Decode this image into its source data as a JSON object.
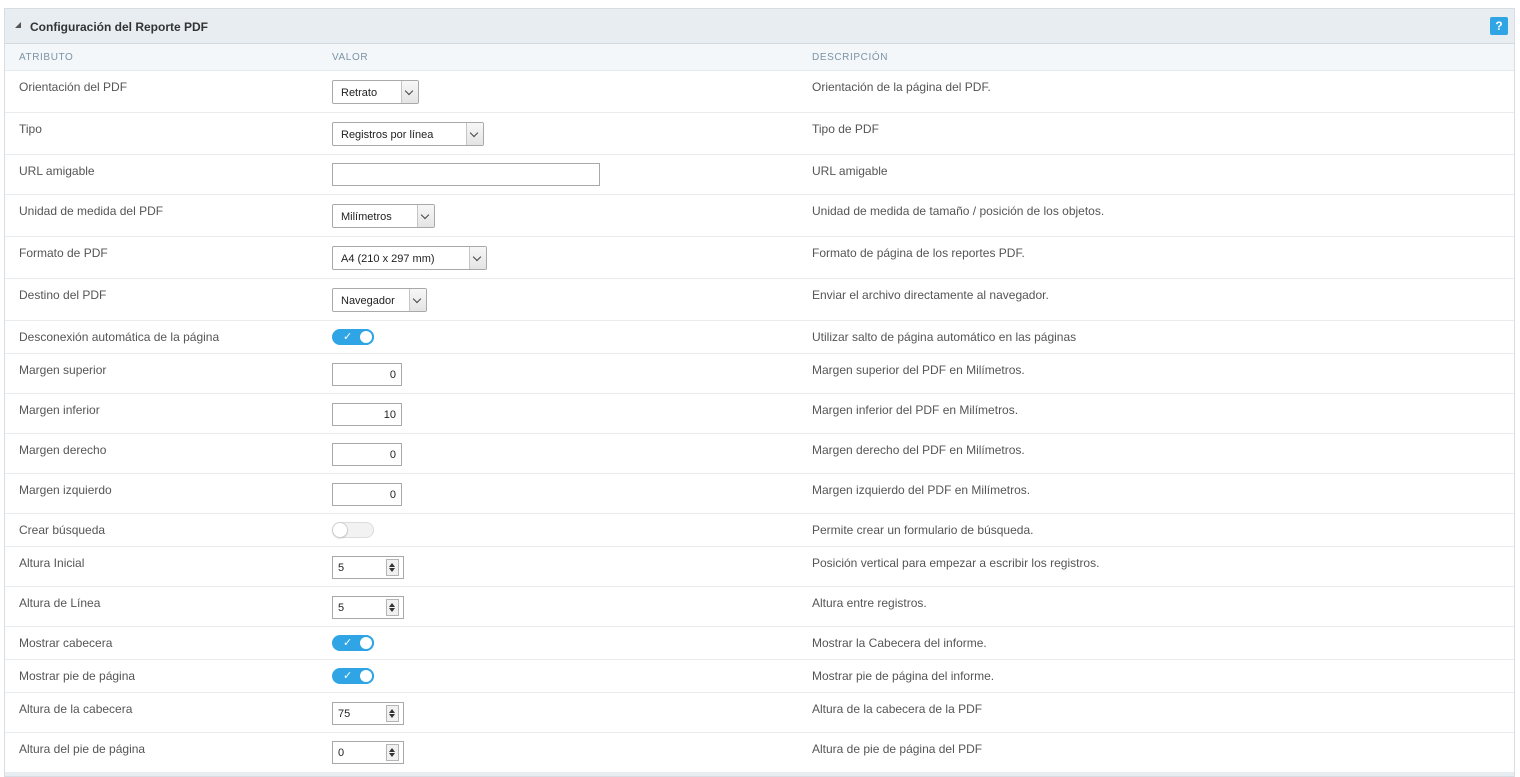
{
  "panel": {
    "title": "Configuración del Reporte PDF",
    "help_label": "?"
  },
  "columns": {
    "attribute": "ATRIBUTO",
    "value": "VALOR",
    "description": "DESCRIPCIÓN"
  },
  "rows": [
    {
      "label": "Orientación del PDF",
      "value": "Retrato",
      "description": "Orientación de la página del PDF."
    },
    {
      "label": "Tipo",
      "value": "Registros por línea",
      "description": "Tipo de PDF"
    },
    {
      "label": "URL amigable",
      "value": "",
      "description": "URL amigable"
    },
    {
      "label": "Unidad de medida del PDF",
      "value": "Milímetros",
      "description": "Unidad de medida de tamaño / posición de los objetos."
    },
    {
      "label": "Formato de PDF",
      "value": "A4 (210 x 297 mm)",
      "description": "Formato de página de los reportes PDF."
    },
    {
      "label": "Destino del PDF",
      "value": "Navegador",
      "description": "Enviar el archivo directamente al navegador."
    },
    {
      "label": "Desconexión automática de la página",
      "value": "on",
      "check": "✓",
      "description": "Utilizar salto de página automático en las páginas"
    },
    {
      "label": "Margen superior",
      "value": "0",
      "description": "Margen superior del PDF en Milímetros."
    },
    {
      "label": "Margen inferior",
      "value": "10",
      "description": "Margen inferior del PDF en Milímetros."
    },
    {
      "label": "Margen derecho",
      "value": "0",
      "description": "Margen derecho del PDF en Milímetros."
    },
    {
      "label": "Margen izquierdo",
      "value": "0",
      "description": "Margen izquierdo del PDF en Milímetros."
    },
    {
      "label": "Crear búsqueda",
      "value": "off",
      "description": "Permite crear un formulario de búsqueda."
    },
    {
      "label": "Altura Inicial",
      "value": "5",
      "description": "Posición vertical para empezar a escribir los registros."
    },
    {
      "label": "Altura de Línea",
      "value": "5",
      "description": "Altura entre registros."
    },
    {
      "label": "Mostrar cabecera",
      "value": "on",
      "check": "✓",
      "description": "Mostrar la Cabecera del informe."
    },
    {
      "label": "Mostrar pie de página",
      "value": "on",
      "check": "✓",
      "description": "Mostrar pie de página del informe."
    },
    {
      "label": "Altura de la cabecera",
      "value": "75",
      "description": "Altura de la cabecera de la PDF"
    },
    {
      "label": "Altura del pie de página",
      "value": "0",
      "description": "Altura de pie de página del PDF"
    }
  ],
  "colors": {
    "accent": "#2fa5e6",
    "header_bg": "#e8edf2",
    "column_header_text": "#7b93a6"
  }
}
